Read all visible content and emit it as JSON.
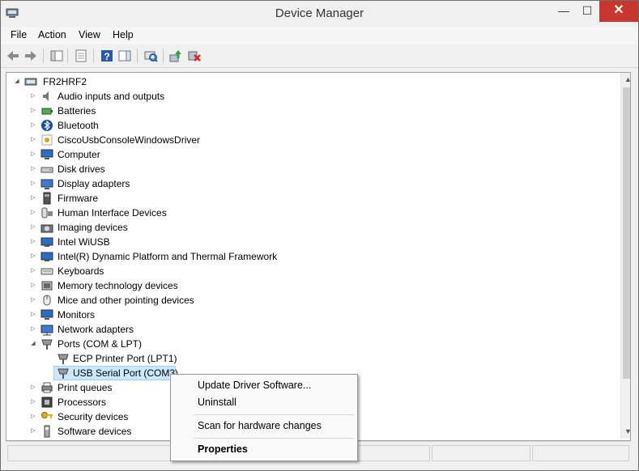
{
  "window": {
    "title": "Device Manager"
  },
  "title_buttons": {
    "minimize": "—",
    "maximize": "☐",
    "close": "✕"
  },
  "menu": {
    "items": [
      "File",
      "Action",
      "View",
      "Help"
    ]
  },
  "toolbar": {
    "icons": [
      "back-arrow-icon",
      "forward-arrow-icon",
      "show-hide-console-tree-icon",
      "properties-icon",
      "help-icon",
      "action-pane-icon",
      "scan-hardware-icon",
      "update-driver-icon",
      "uninstall-icon"
    ]
  },
  "tree": {
    "root": "FR2HRF2",
    "categories": [
      "Audio inputs and outputs",
      "Batteries",
      "Bluetooth",
      "CiscoUsbConsoleWindowsDriver",
      "Computer",
      "Disk drives",
      "Display adapters",
      "Firmware",
      "Human Interface Devices",
      "Imaging devices",
      "Intel WiUSB",
      "Intel(R) Dynamic Platform and Thermal Framework",
      "Keyboards",
      "Memory technology devices",
      "Mice and other pointing devices",
      "Monitors",
      "Network adapters",
      "Ports (COM & LPT)"
    ],
    "ports_children": [
      "ECP Printer Port (LPT1)",
      "USB Serial Port (COM3)"
    ],
    "after_categories": [
      "Print queues",
      "Processors",
      "Security devices",
      "Software devices"
    ]
  },
  "context_menu": {
    "update": "Update Driver Software...",
    "uninstall": "Uninstall",
    "scan": "Scan for hardware changes",
    "properties": "Properties"
  },
  "colors": {
    "selection": "#cce8ff",
    "close_button": "#c8372d"
  }
}
